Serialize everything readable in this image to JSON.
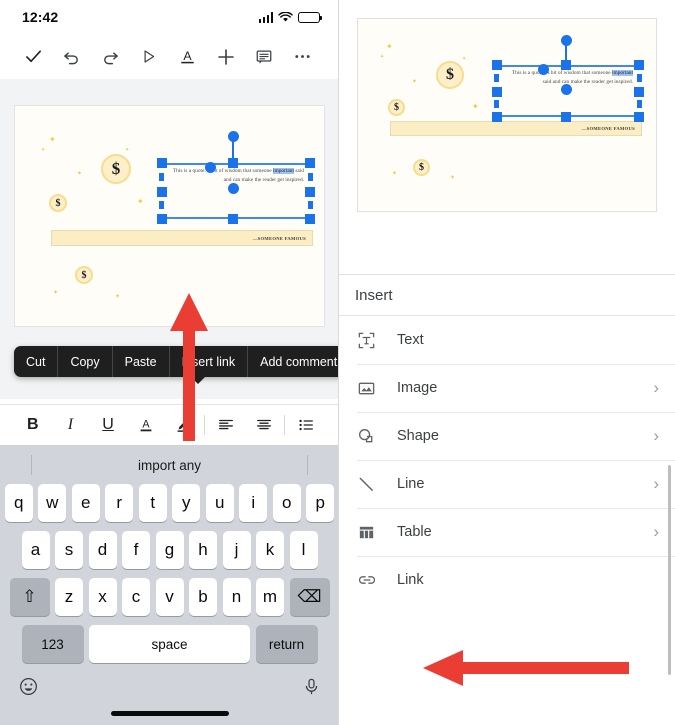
{
  "status_bar": {
    "time": "12:42",
    "signal_icon": "cellular-signal-icon",
    "wifi_icon": "wifi-icon",
    "battery_icon": "battery-icon"
  },
  "toolbar": {
    "done_label": "✓",
    "undo_label": "↶",
    "redo_label": "↷",
    "present_label": "▷",
    "format_label": "A",
    "insert_label": "+",
    "comment_label": "▤",
    "more_label": "⋯"
  },
  "slide": {
    "quote_text_before": "This is a quote. A bit of wisdom that someone ",
    "quote_highlight": "important",
    "quote_text_after": " said and can make the reader get inspired.",
    "attribution": "—SOMEONE FAMOUS",
    "coin_symbol": "$"
  },
  "context_menu": {
    "items": [
      {
        "label": "Cut"
      },
      {
        "label": "Copy"
      },
      {
        "label": "Paste"
      },
      {
        "label": "Insert link"
      },
      {
        "label": "Add comment"
      }
    ]
  },
  "format_bar": {
    "bold": "B",
    "italic": "I",
    "underline": "U",
    "text_color": "A",
    "highlight_icon": "highlighter-icon",
    "align_left_icon": "align-left-icon",
    "align_center_icon": "align-center-icon",
    "list_icon": "bulleted-list-icon"
  },
  "keyboard": {
    "suggestion": "import any",
    "row1": [
      "q",
      "w",
      "e",
      "r",
      "t",
      "y",
      "u",
      "i",
      "o",
      "p"
    ],
    "row2": [
      "a",
      "s",
      "d",
      "f",
      "g",
      "h",
      "j",
      "k",
      "l"
    ],
    "row3": [
      "z",
      "x",
      "c",
      "v",
      "b",
      "n",
      "m"
    ],
    "shift_label": "⇧",
    "backspace_label": "⌫",
    "numbers_label": "123",
    "space_label": "space",
    "return_label": "return",
    "emoji_label": "☺",
    "mic_label": "mic-icon"
  },
  "insert_panel": {
    "title": "Insert",
    "items": [
      {
        "label": "Text",
        "icon": "text-box-icon",
        "chevron": ""
      },
      {
        "label": "Image",
        "icon": "image-icon",
        "chevron": "›"
      },
      {
        "label": "Shape",
        "icon": "shape-icon",
        "chevron": "›"
      },
      {
        "label": "Line",
        "icon": "line-icon",
        "chevron": "›"
      },
      {
        "label": "Table",
        "icon": "table-icon",
        "chevron": "›"
      },
      {
        "label": "Link",
        "icon": "link-icon",
        "chevron": ""
      }
    ]
  },
  "annotations": {
    "arrow_color": "#ea3d34",
    "left_arrow_target": "Insert link",
    "right_arrow_target": "Link"
  },
  "colors": {
    "selection_blue": "#1a73e8",
    "highlight_blue": "#9ec1f7",
    "coin_fill": "#fdf0c8",
    "banner_fill": "#fbeec4"
  }
}
